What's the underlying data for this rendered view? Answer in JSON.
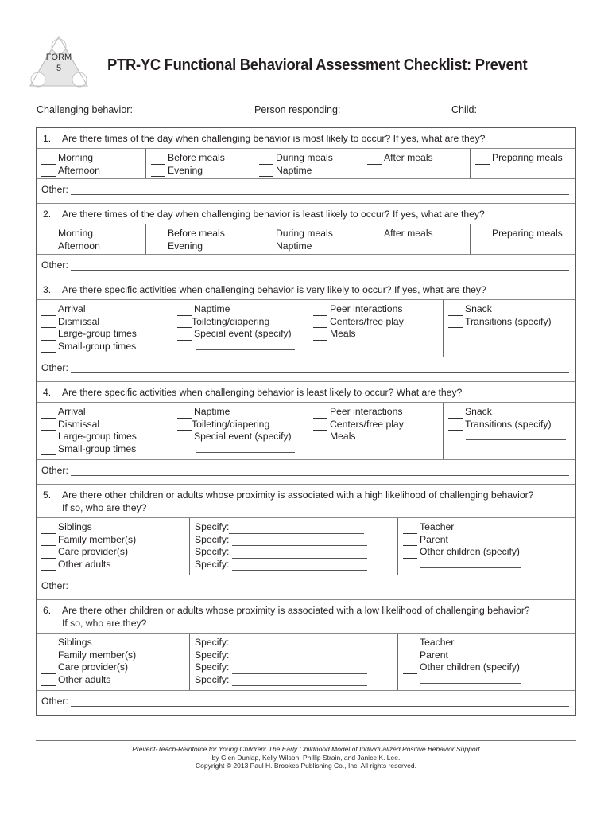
{
  "logo": {
    "line1": "FORM",
    "line2": "5"
  },
  "title": "PTR-YC Functional Behavioral Assessment Checklist: Prevent",
  "header_fields": [
    {
      "label": "Challenging behavior:",
      "value": ""
    },
    {
      "label": "Person responding:",
      "value": ""
    },
    {
      "label": "Child:",
      "value": ""
    }
  ],
  "other_label": "Other:",
  "questions": [
    {
      "number": "1.",
      "text": "Are there times of the day when challenging behavior is most likely to occur? If yes, what are they?",
      "columns": [
        [
          "Morning",
          "Afternoon"
        ],
        [
          "Before meals",
          "Evening"
        ],
        [
          "During meals",
          "Naptime"
        ],
        [
          "After meals"
        ],
        [
          "Preparing meals"
        ]
      ],
      "other": ""
    },
    {
      "number": "2.",
      "text": "Are there times of the day when challenging behavior is least likely to occur? If yes, what are they?",
      "columns": [
        [
          "Morning",
          "Afternoon"
        ],
        [
          "Before meals",
          "Evening"
        ],
        [
          "During meals",
          "Naptime"
        ],
        [
          "After meals"
        ],
        [
          "Preparing meals"
        ]
      ],
      "other": ""
    },
    {
      "number": "3.",
      "text": "Are there specific activities when challenging behavior is very likely to occur? If yes, what are they?",
      "columns": [
        [
          "Arrival",
          "Dismissal",
          "Large-group times",
          "Small-group times"
        ],
        [
          "Naptime",
          "Toileting/diapering",
          "Special event (specify)"
        ],
        [
          "Peer interactions",
          "Centers/free play",
          "Meals"
        ],
        [
          "Snack",
          "Transitions (specify)"
        ]
      ],
      "other": ""
    },
    {
      "number": "4.",
      "text": "Are there specific activities when challenging behavior is least likely to occur? What are they?",
      "columns": [
        [
          "Arrival",
          "Dismissal",
          "Large-group times",
          "Small-group times"
        ],
        [
          "Naptime",
          "Toileting/diapering",
          "Special event (specify)"
        ],
        [
          "Peer interactions",
          "Centers/free play",
          "Meals"
        ],
        [
          "Snack",
          "Transitions (specify)"
        ]
      ],
      "other": ""
    },
    {
      "number": "5.",
      "text": "Are there other children or adults whose proximity is associated with a high likelihood of challenging behavior? If so, who are they?",
      "people": [
        "Siblings",
        "Family member(s)",
        "Care provider(s)",
        "Other adults"
      ],
      "specify_label": "Specify:",
      "others": [
        "Teacher",
        "Parent",
        "Other children (specify)"
      ],
      "other": ""
    },
    {
      "number": "6.",
      "text": "Are there other children or adults whose proximity is associated with a low likelihood of challenging behavior? If so, who are they?",
      "people": [
        "Siblings",
        "Family member(s)",
        "Care provider(s)",
        "Other adults"
      ],
      "specify_label": "Specify:",
      "others": [
        "Teacher",
        "Parent",
        "Other children (specify)"
      ],
      "other": ""
    }
  ],
  "footer": {
    "book_title": "Prevent-Teach-Reinforce for Young Children: The Early Childhood Model of Individualized Positive Behavior Support",
    "authors": "by Glen Dunlap, Kelly Wilson, Phillip Strain, and Janice K. Lee.",
    "copyright": "Copyright © 2013 Paul H. Brookes Publishing Co., Inc. All rights reserved."
  }
}
